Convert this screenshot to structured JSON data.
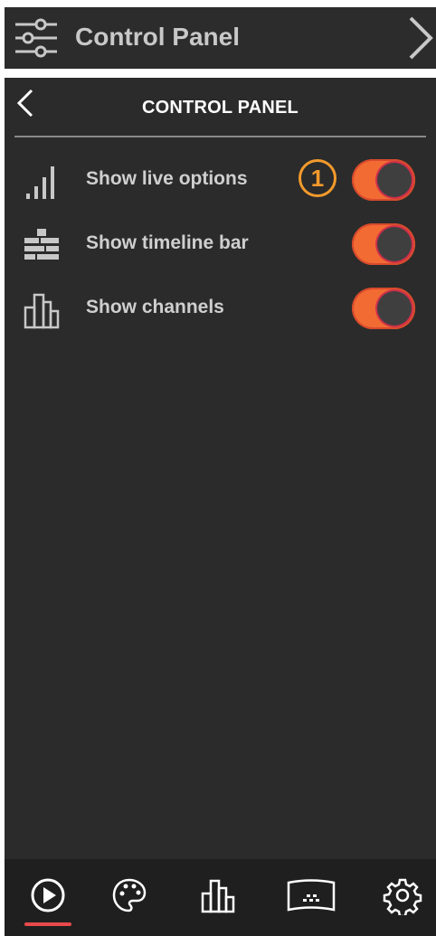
{
  "topbar": {
    "title": "Control Panel",
    "icon": "sliders-icon",
    "action_icon": "chevron-right-icon"
  },
  "panel": {
    "title": "CONTROL PANEL",
    "back_icon": "chevron-left-icon",
    "rows": [
      {
        "label": "Show live options",
        "icon": "signal-bars-icon",
        "toggle_on": true,
        "badge": "1"
      },
      {
        "label": "Show timeline bar",
        "icon": "timeline-stack-icon",
        "toggle_on": true
      },
      {
        "label": "Show channels",
        "icon": "channels-bars-icon",
        "toggle_on": true
      }
    ]
  },
  "bottom_nav": {
    "items": [
      "play-icon",
      "palette-icon",
      "channels-icon",
      "screen-icon",
      "settings-icon"
    ],
    "active": 0
  },
  "colors": {
    "toggle_on": "#f26b33",
    "badge": "#f39a2c",
    "active_indicator": "#e8494a",
    "panel_bg": "#2b2b2b"
  }
}
